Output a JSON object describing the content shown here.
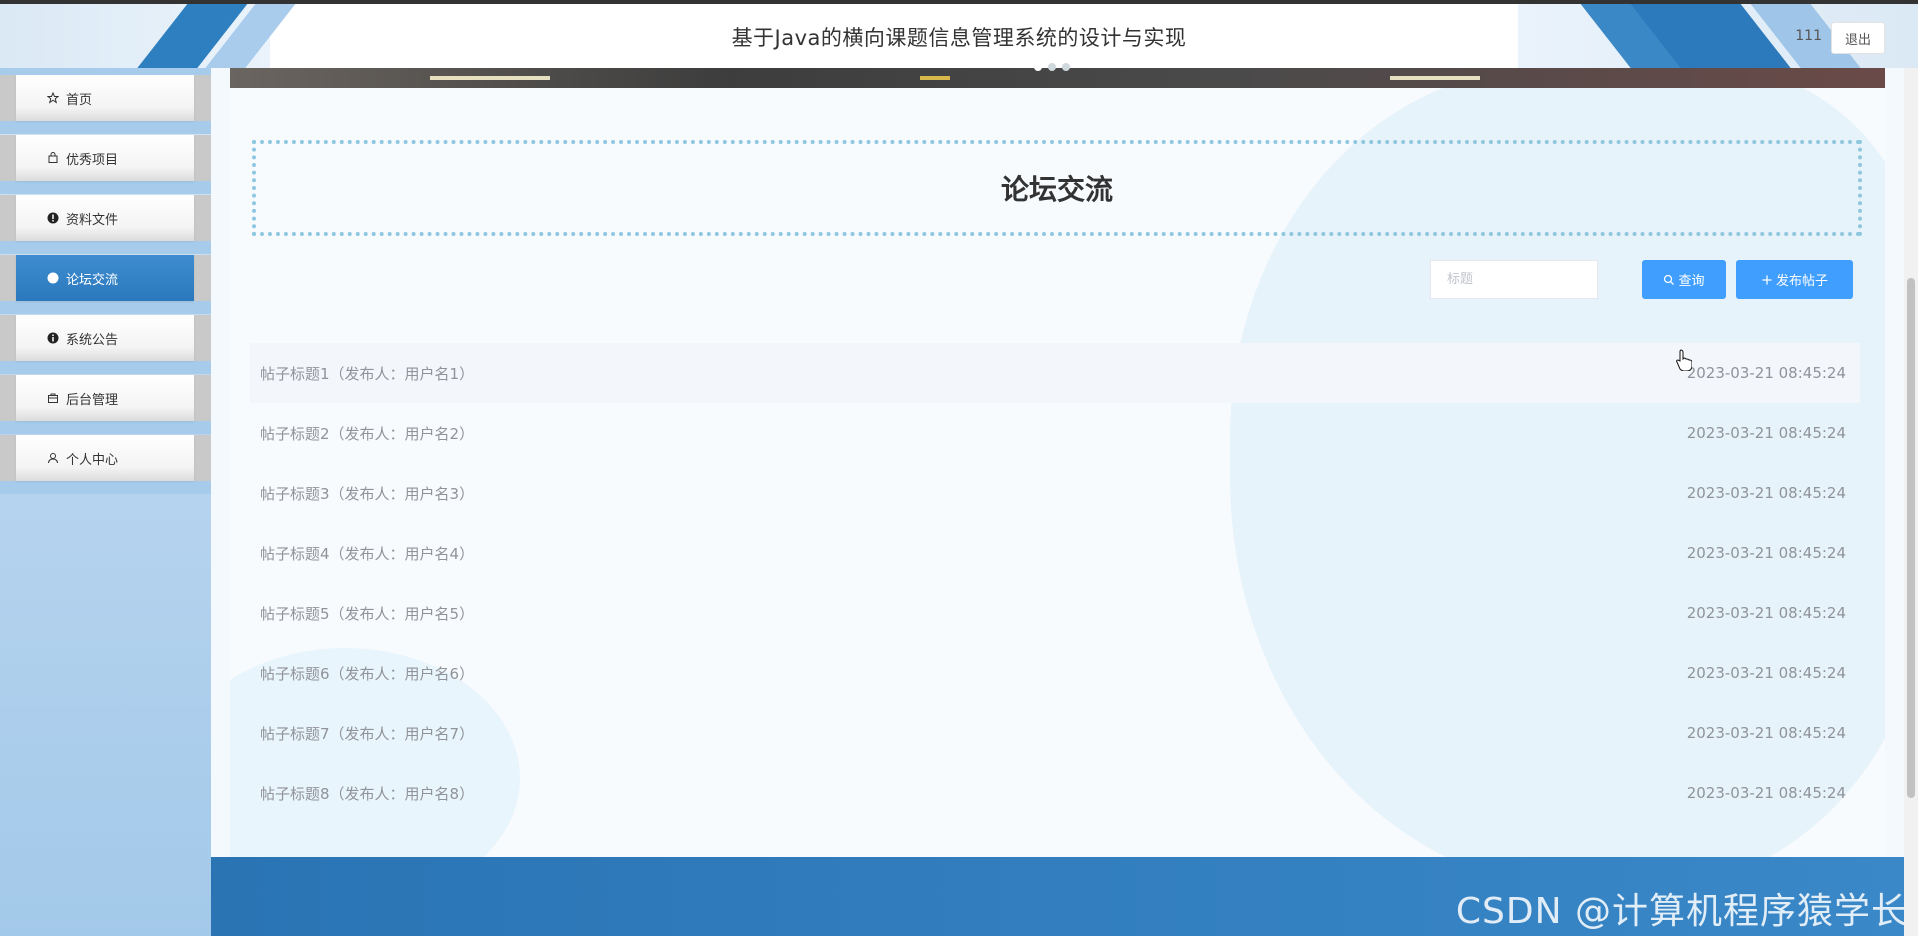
{
  "header": {
    "title": "基于Java的横向课题信息管理系统的设计与实现",
    "username": "111",
    "logout_label": "退出"
  },
  "sidebar": {
    "items": [
      {
        "label": "首页",
        "icon": "star-icon"
      },
      {
        "label": "优秀项目",
        "icon": "bag-icon"
      },
      {
        "label": "资料文件",
        "icon": "info-circle-icon"
      },
      {
        "label": "论坛交流",
        "icon": "circle-icon",
        "active": true
      },
      {
        "label": "系统公告",
        "icon": "info-icon"
      },
      {
        "label": "后台管理",
        "icon": "box-icon"
      },
      {
        "label": "个人中心",
        "icon": "user-icon"
      }
    ]
  },
  "page": {
    "heading": "论坛交流"
  },
  "search": {
    "placeholder": "标题",
    "query_label": "查询",
    "post_label": "发布帖子"
  },
  "posts": [
    {
      "title": "帖子标题1（发布人：用户名1）",
      "time": "2023-03-21 08:45:24"
    },
    {
      "title": "帖子标题2（发布人：用户名2）",
      "time": "2023-03-21 08:45:24"
    },
    {
      "title": "帖子标题3（发布人：用户名3）",
      "time": "2023-03-21 08:45:24"
    },
    {
      "title": "帖子标题4（发布人：用户名4）",
      "time": "2023-03-21 08:45:24"
    },
    {
      "title": "帖子标题5（发布人：用户名5）",
      "time": "2023-03-21 08:45:24"
    },
    {
      "title": "帖子标题6（发布人：用户名6）",
      "time": "2023-03-21 08:45:24"
    },
    {
      "title": "帖子标题7（发布人：用户名7）",
      "time": "2023-03-21 08:45:24"
    },
    {
      "title": "帖子标题8（发布人：用户名8）",
      "time": "2023-03-21 08:45:24"
    }
  ],
  "watermark": "CSDN @计算机程序猿学长",
  "colors": {
    "accent": "#409eff",
    "sidebar_active": "#2b78bd",
    "footer": "#2a74b4"
  }
}
